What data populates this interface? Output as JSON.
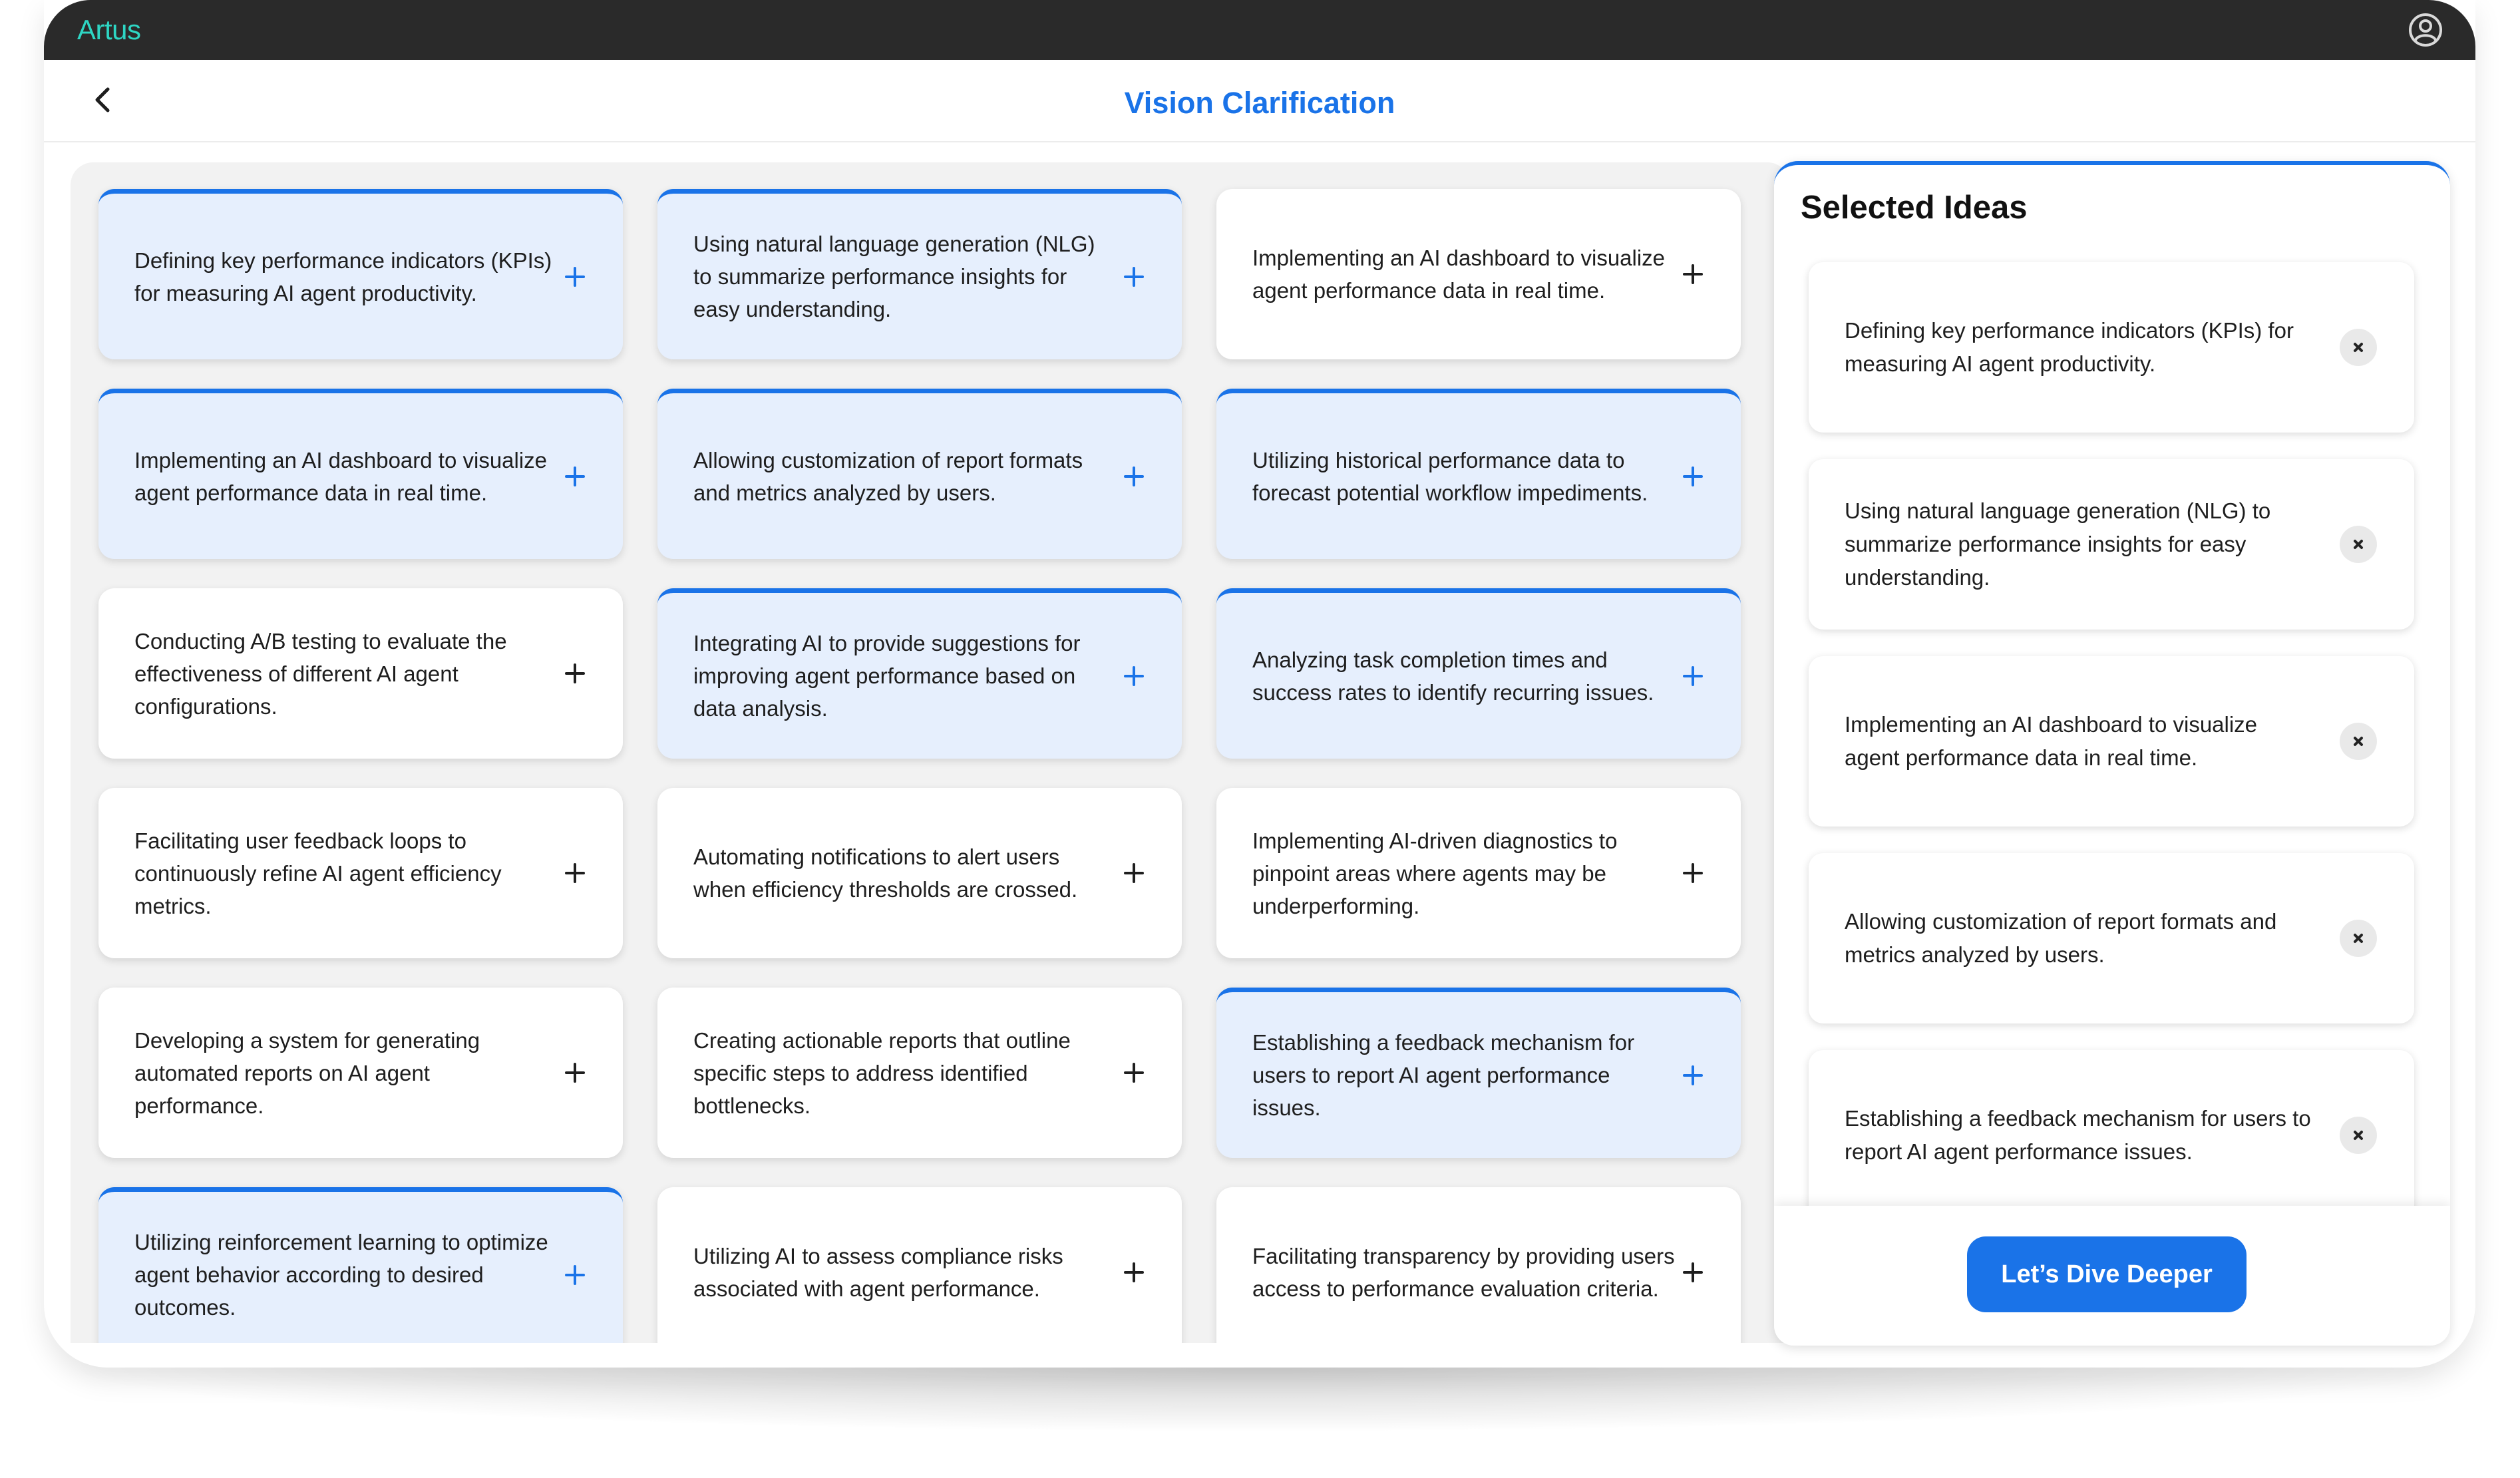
{
  "app": {
    "brand": "Artus",
    "account_icon": "account-circle-icon"
  },
  "header": {
    "title": "Vision Clarification",
    "back_icon": "chevron-left-icon"
  },
  "colors": {
    "accent": "#1a73e8",
    "brand": "#2ed6c4",
    "selected_card_bg": "#e6effd",
    "topbar": "#2a2a2a"
  },
  "ideas": [
    {
      "text": "Defining key performance indicators (KPIs) for measuring AI agent productivity.",
      "selected": true
    },
    {
      "text": "Using natural language generation (NLG) to summarize performance insights for easy understanding.",
      "selected": true
    },
    {
      "text": "Implementing an AI dashboard to visualize agent performance data in real time.",
      "selected": false
    },
    {
      "text": "Implementing an AI dashboard to visualize agent performance data in real time.",
      "selected": true
    },
    {
      "text": "Allowing customization of report formats and metrics analyzed by users.",
      "selected": true
    },
    {
      "text": "Utilizing historical performance data to forecast potential workflow impediments.",
      "selected": true
    },
    {
      "text": "Conducting A/B testing to evaluate the effectiveness of different AI agent configurations.",
      "selected": false
    },
    {
      "text": "Integrating AI to provide suggestions for improving agent performance based on data analysis.",
      "selected": true
    },
    {
      "text": "Analyzing task completion times and success rates to identify recurring issues.",
      "selected": true
    },
    {
      "text": "Facilitating user feedback loops to continuously refine AI agent efficiency metrics.",
      "selected": false
    },
    {
      "text": "Automating notifications to alert users when efficiency thresholds are crossed.",
      "selected": false
    },
    {
      "text": "Implementing AI-driven diagnostics to pinpoint areas where agents may be underperforming.",
      "selected": false
    },
    {
      "text": "Developing a system for generating automated reports on AI agent performance.",
      "selected": false
    },
    {
      "text": "Creating actionable reports that outline specific steps to address identified bottlenecks.",
      "selected": false
    },
    {
      "text": "Establishing a feedback mechanism for users to report AI agent performance issues.",
      "selected": true
    },
    {
      "text": "Utilizing reinforcement learning to optimize agent behavior according to desired outcomes.",
      "selected": true
    },
    {
      "text": "Utilizing AI to assess compliance risks associated with agent performance.",
      "selected": false
    },
    {
      "text": "Facilitating transparency by providing users access to performance evaluation criteria.",
      "selected": false
    }
  ],
  "add_icon": "plus-icon",
  "selected_panel": {
    "title": "Selected Ideas",
    "remove_icon": "close-icon",
    "items": [
      {
        "text": "Defining key performance indicators (KPIs) for measuring AI agent productivity."
      },
      {
        "text": "Using natural language generation (NLG) to summarize performance insights for easy understanding."
      },
      {
        "text": "Implementing an AI dashboard to visualize agent performance data in real time."
      },
      {
        "text": "Allowing customization of report formats and metrics analyzed by users."
      },
      {
        "text": "Establishing a feedback mechanism for users to report AI agent performance issues."
      }
    ],
    "cta_label": "Let’s Dive Deeper"
  }
}
